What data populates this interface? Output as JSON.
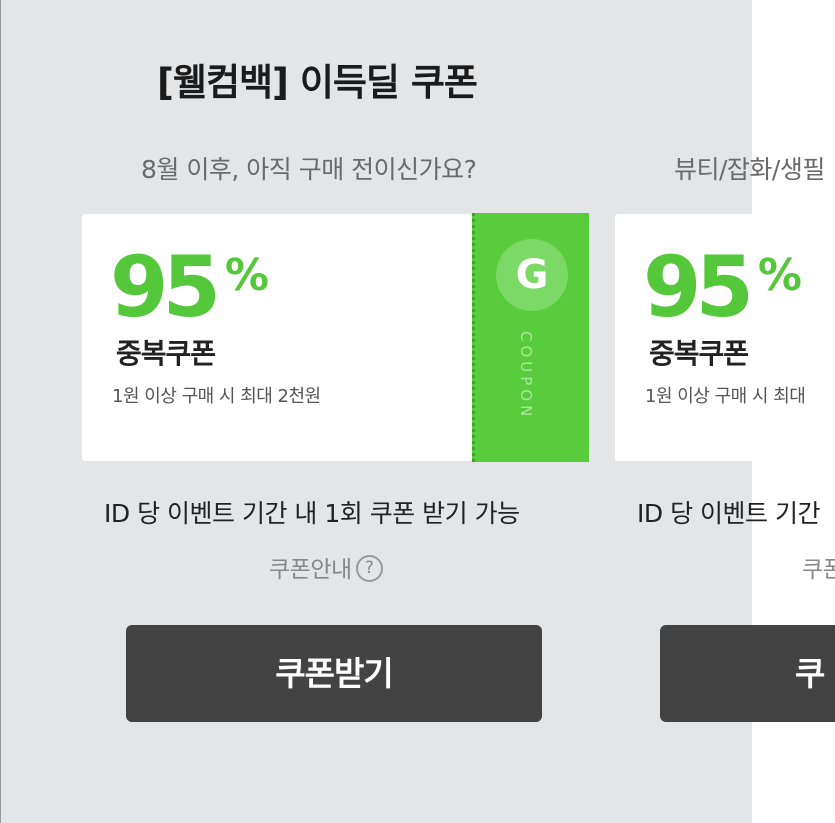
{
  "page_title": "[웰컴백] 이득딜 쿠폰",
  "coupons": [
    {
      "subtitle": "8월 이후, 아직 구매 전이신가요?",
      "discount_value": "95",
      "discount_unit": "%",
      "name": "중복쿠폰",
      "condition": "1원 이상 구매 시 최대 2천원",
      "stub_letter": "G",
      "stub_label": "COUPON",
      "limit_text": "ID 당 이벤트 기간 내 1회 쿠폰 받기 가능",
      "guide_label": "쿠폰안내",
      "help_glyph": "?",
      "button_label": "쿠폰받기"
    },
    {
      "subtitle": "뷰티/잡화/생필",
      "discount_value": "95",
      "discount_unit": "%",
      "name": "중복쿠폰",
      "condition": "1원 이상 구매 시 최대",
      "limit_text": "ID 당 이벤트 기간",
      "guide_label": "쿠폰",
      "button_label": "쿠"
    }
  ],
  "colors": {
    "accent_green": "#59cc3e",
    "discount_green": "#54c83a",
    "button_dark": "#434343",
    "panel_bg": "#e4e5e7"
  },
  "icons": {
    "brand": "g-logo-icon",
    "help": "question-circle-icon"
  }
}
